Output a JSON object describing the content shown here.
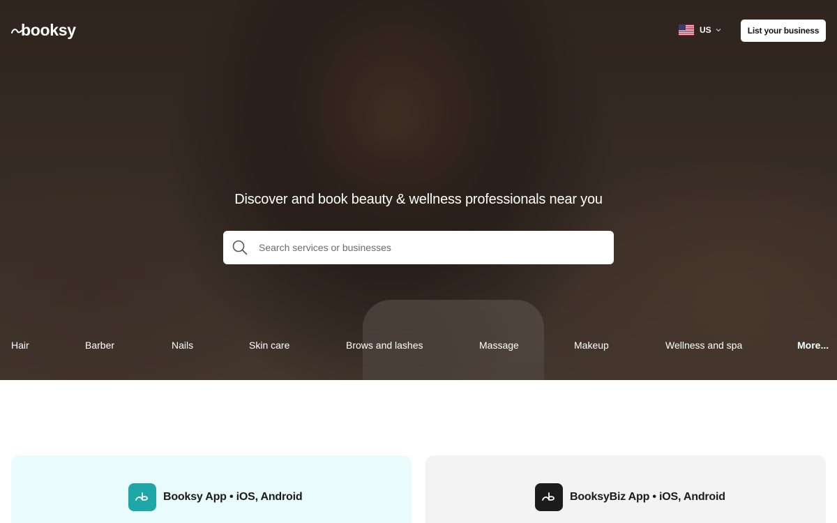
{
  "header": {
    "logo_text": "booksy",
    "locale_code": "US",
    "list_business_label": "List your business"
  },
  "hero": {
    "headline": "Discover and book beauty & wellness professionals near you",
    "search_placeholder": "Search services or businesses"
  },
  "categories": [
    "Hair",
    "Barber",
    "Nails",
    "Skin care",
    "Brows and lashes",
    "Massage",
    "Makeup",
    "Wellness and spa",
    "More..."
  ],
  "apps": {
    "consumer_title": "Booksy App • iOS, Android",
    "biz_title": "BooksyBiz App • iOS, Android"
  },
  "icons": {
    "logo": "booksy-swoosh-icon",
    "flag": "us-flag-icon",
    "chevron": "chevron-down-icon",
    "search": "search-icon",
    "app": "booksy-app-icon"
  },
  "colors": {
    "consumer_card_bg": "#eafbfc",
    "biz_card_bg": "#f3f3f3",
    "consumer_icon": "#1fa6a6",
    "biz_icon": "#1c1c1c"
  }
}
